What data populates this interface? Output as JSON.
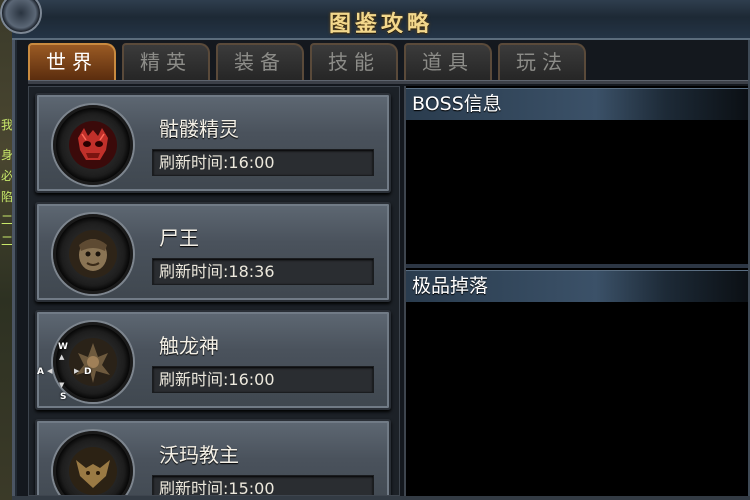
{
  "window": {
    "title": "图鉴攻略"
  },
  "tabs": [
    {
      "label": "世界",
      "active": true
    },
    {
      "label": "精英",
      "active": false
    },
    {
      "label": "装备",
      "active": false
    },
    {
      "label": "技能",
      "active": false
    },
    {
      "label": "道具",
      "active": false
    },
    {
      "label": "玩法",
      "active": false
    }
  ],
  "boss_list": [
    {
      "name": "骷髅精灵",
      "refresh_label": "刷新时间:",
      "refresh_time": "16:00",
      "portrait": "red-demon-skull-icon"
    },
    {
      "name": "尸王",
      "refresh_label": "刷新时间:",
      "refresh_time": "18:36",
      "portrait": "zombie-king-icon"
    },
    {
      "name": "触龙神",
      "refresh_label": "刷新时间:",
      "refresh_time": "16:00",
      "portrait": "tentacle-dragon-icon"
    },
    {
      "name": "沃玛教主",
      "refresh_label": "刷新时间:",
      "refresh_time": "15:00",
      "portrait": "woma-leader-icon"
    }
  ],
  "wasd": {
    "w": "W",
    "a": "A",
    "s": "S",
    "d": "D"
  },
  "right": {
    "boss_info_title": "BOSS信息",
    "drops_title": "极品掉落"
  },
  "world_strip": [
    "我",
    "身",
    "必",
    "陷",
    "二",
    "二"
  ],
  "colors": {
    "title_gold": "#f3d88c",
    "active_tab": "#9a5a24",
    "panel_bg": "#14181e",
    "card_bg": "#4a525c"
  }
}
